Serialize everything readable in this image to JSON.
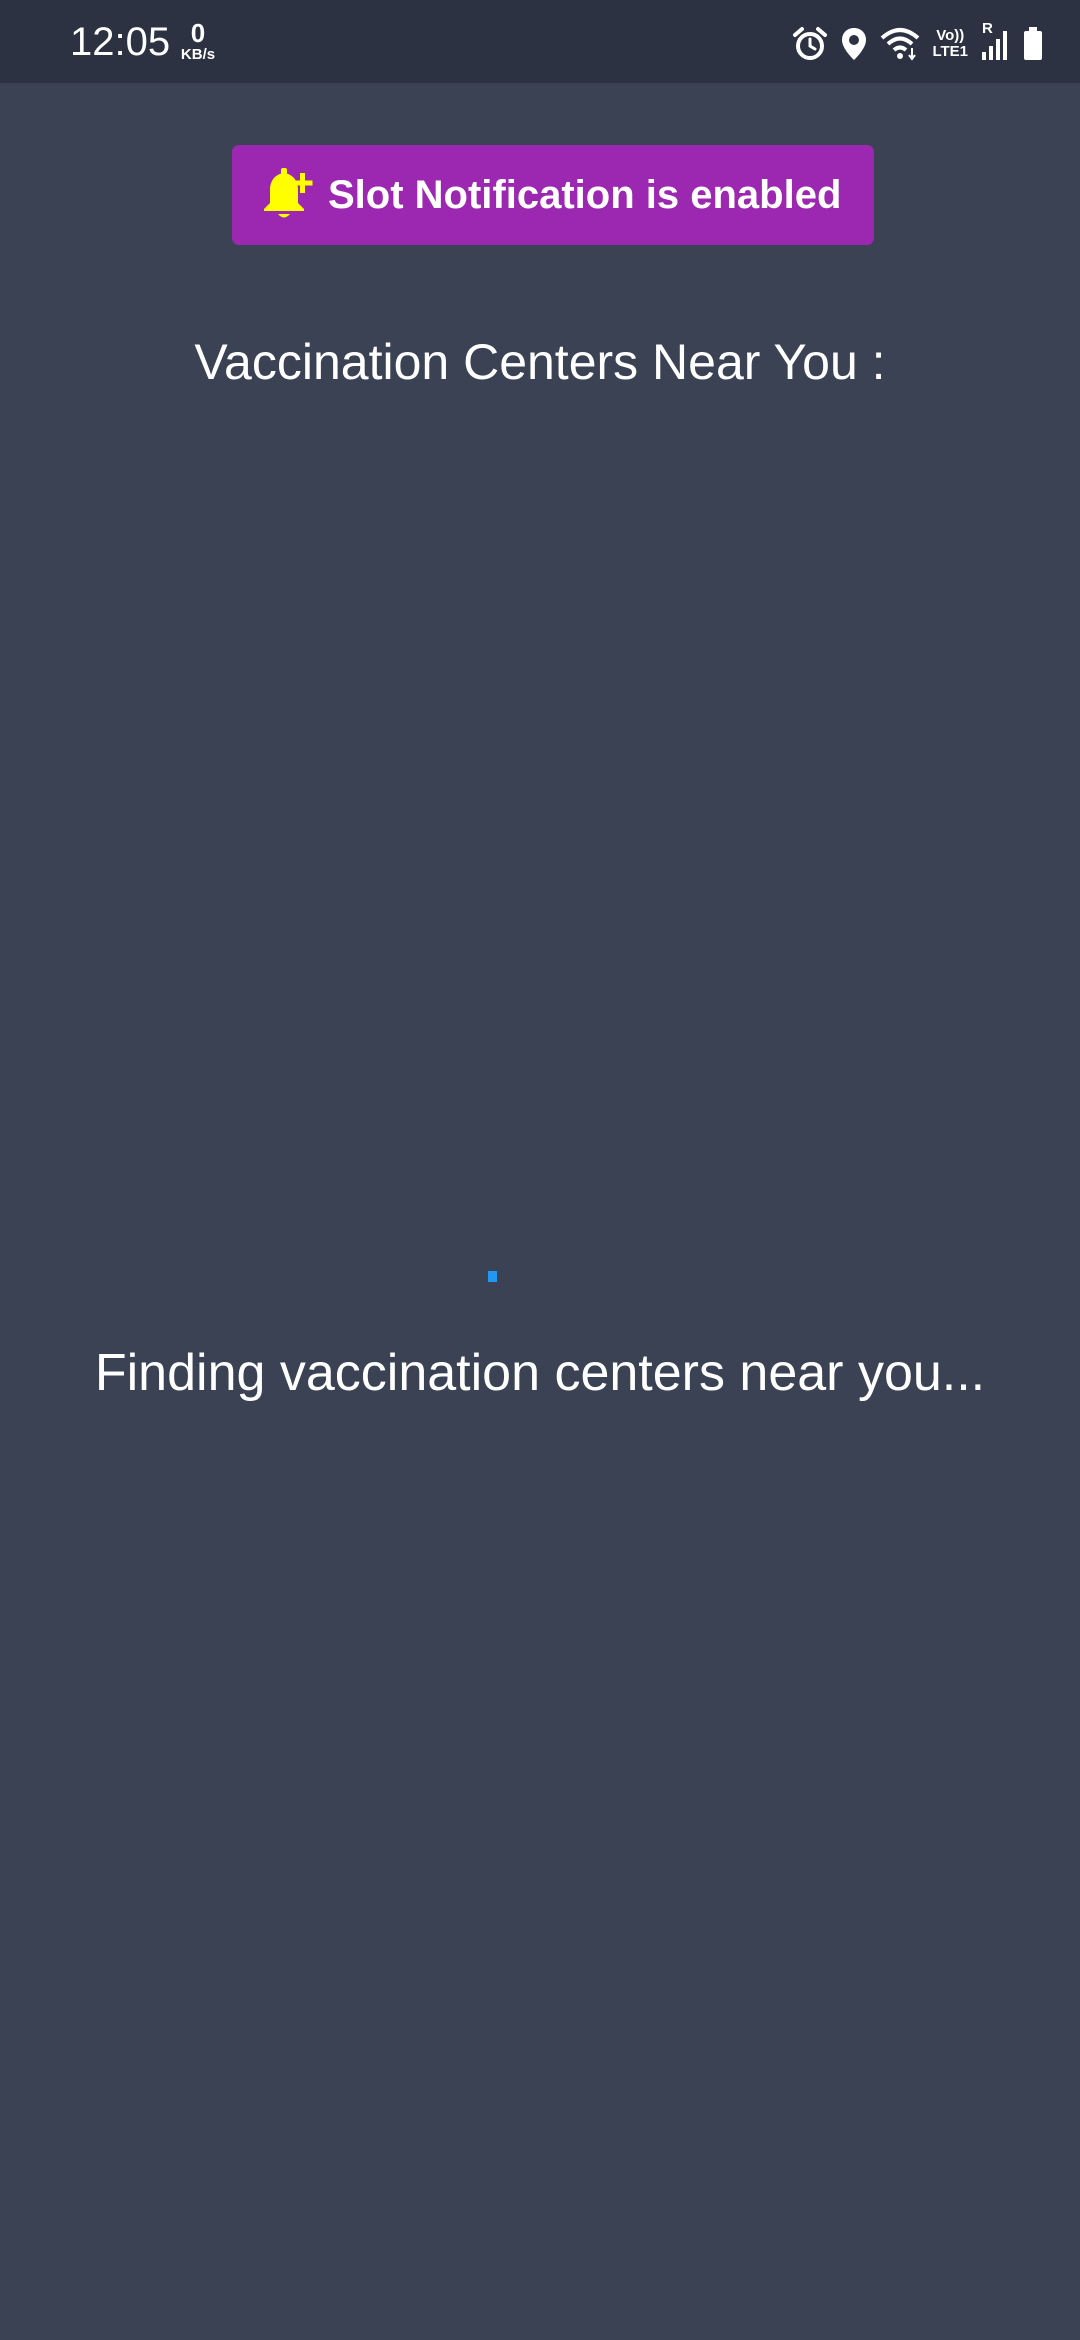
{
  "status_bar": {
    "time": "12:05",
    "net_speed_value": "0",
    "net_speed_unit": "KB/s",
    "network_label_top": "Vo))",
    "network_label_bottom": "LTE1",
    "roaming_label": "R",
    "icons": [
      "alarm-icon",
      "location-icon",
      "wifi-icon",
      "signal-icon",
      "battery-icon"
    ]
  },
  "notification_button": {
    "icon": "bell-plus-icon",
    "label": "Slot Notification is enabled",
    "background": "#9c27b0",
    "icon_color": "#ffff00"
  },
  "main": {
    "title": "Vaccination Centers Near You :",
    "loading_text": "Finding vaccination centers near you...",
    "loader_color": "#2196f3"
  },
  "theme": {
    "background": "#3a4254",
    "status_bar_background": "#2c3241"
  }
}
